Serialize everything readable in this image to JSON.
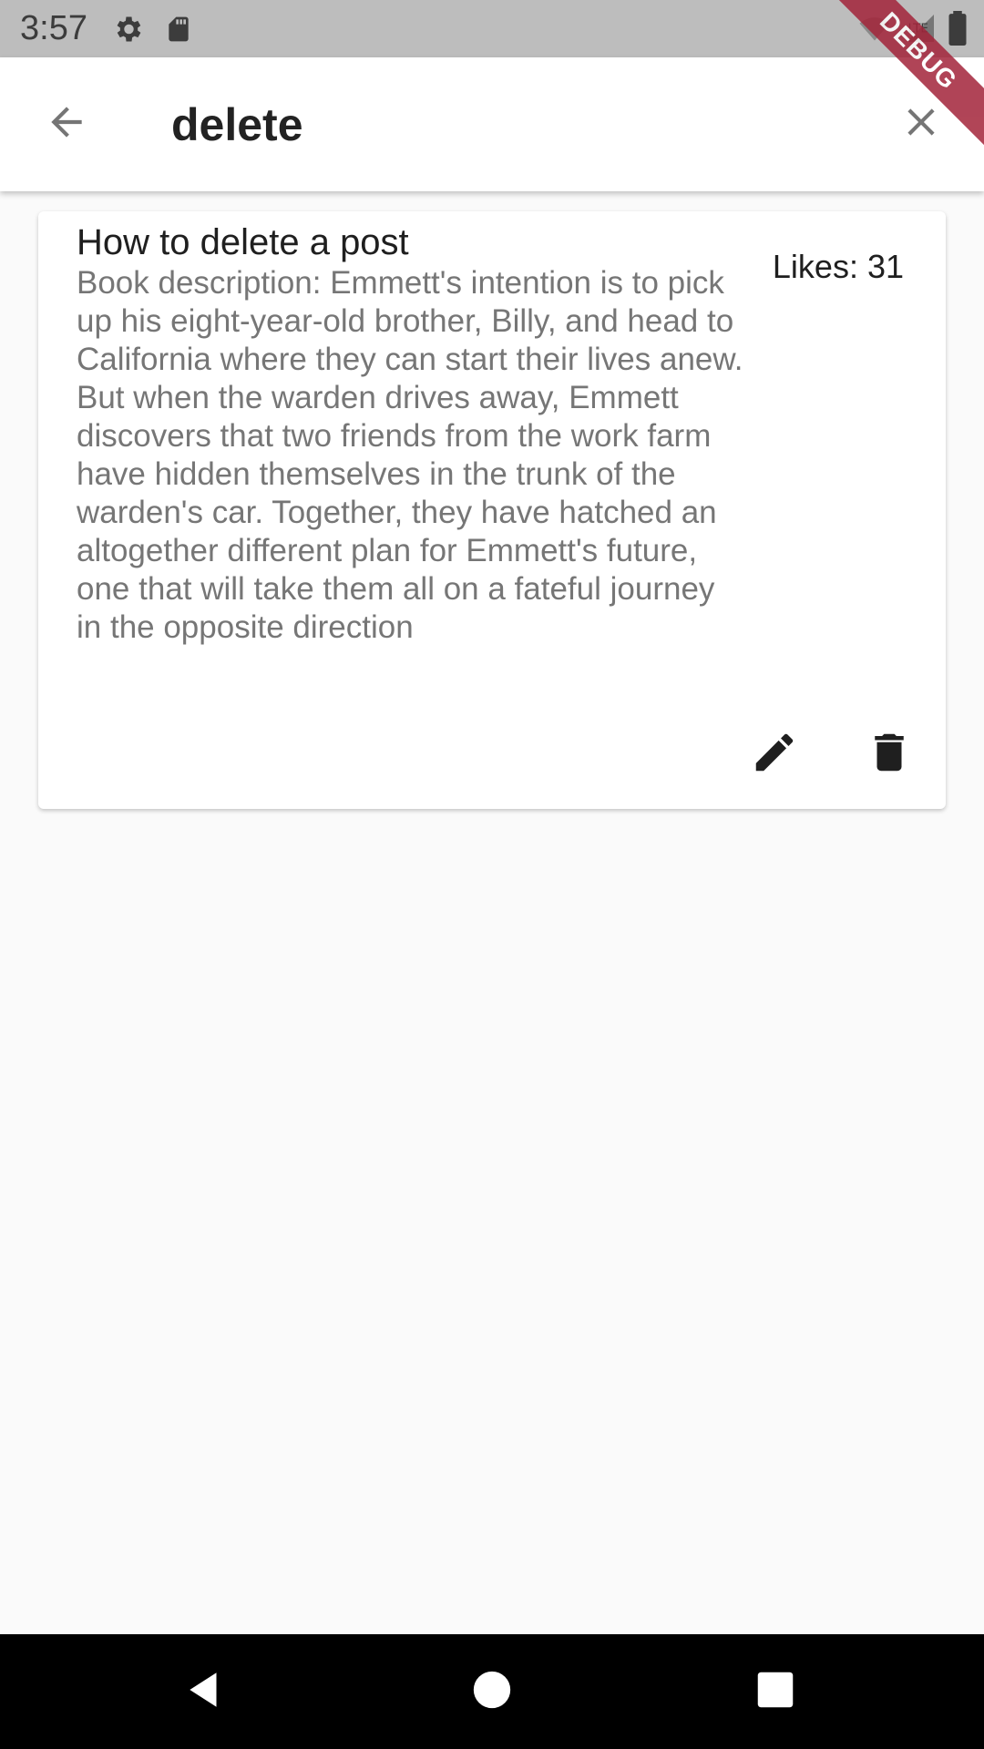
{
  "status_bar": {
    "time": "3:57",
    "icons": [
      "settings-icon",
      "sd-card-icon",
      "wifi-icon",
      "signal-icon",
      "battery-icon"
    ]
  },
  "debug_banner": {
    "label": "DEBUG"
  },
  "app_bar": {
    "back_icon": "arrow-back-icon",
    "search_value": "delete",
    "clear_icon": "close-icon"
  },
  "posts": [
    {
      "title": "How to delete a post",
      "description": "Book description: Emmett's intention is to pick up his eight-year-old brother, Billy, and head to California where they can start their lives anew. But when the warden drives away, Emmett discovers that two friends from the work farm have hidden themselves in the trunk of the warden's car. Together, they have hatched an altogether different plan for Emmett's future, one that will take them all on a fateful journey in the opposite direction",
      "likes": "Likes: 31",
      "actions": [
        "edit-icon",
        "delete-icon"
      ]
    }
  ],
  "nav_bar": {
    "buttons": [
      "back-nav-icon",
      "home-nav-icon",
      "recents-nav-icon"
    ]
  },
  "colors": {
    "status_bar": "#bdbdbd",
    "app_bar": "#ffffff",
    "background": "#fafafa",
    "debug_banner": "#a3243a",
    "nav_bar": "#000000"
  }
}
